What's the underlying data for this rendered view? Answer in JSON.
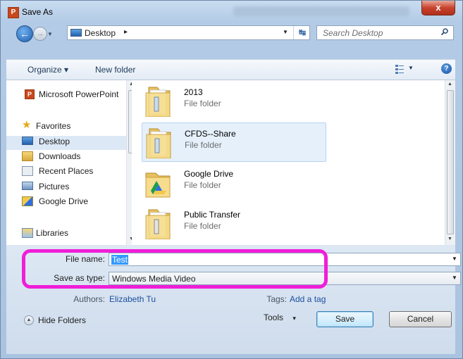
{
  "window": {
    "title": "Save As",
    "app_icon_letter": "P",
    "close_glyph": "x"
  },
  "address_bar": {
    "location": "Desktop",
    "chevron": "▸",
    "search_placeholder": "Search Desktop"
  },
  "toolbar": {
    "organize_label": "Organize ▾",
    "new_folder_label": "New folder",
    "help_glyph": "?"
  },
  "nav_pane": {
    "items": [
      {
        "label": "Microsoft PowerPoint",
        "icon": "powerpoint-icon"
      },
      {
        "label": "Favorites",
        "icon": "star-icon"
      },
      {
        "label": "Desktop",
        "icon": "desktop-icon",
        "selected": true
      },
      {
        "label": "Downloads",
        "icon": "downloads-icon"
      },
      {
        "label": "Recent Places",
        "icon": "recent-places-icon"
      },
      {
        "label": "Pictures",
        "icon": "pictures-icon"
      },
      {
        "label": "Google Drive",
        "icon": "google-drive-icon"
      },
      {
        "label": "Libraries",
        "icon": "libraries-icon"
      }
    ]
  },
  "files": [
    {
      "name": "2013",
      "type": "File folder",
      "icon": "folder-icon"
    },
    {
      "name": "CFDS--Share",
      "type": "File folder",
      "icon": "folder-icon",
      "selected": true
    },
    {
      "name": "Google Drive",
      "type": "File folder",
      "icon": "google-drive-folder-icon"
    },
    {
      "name": "Public Transfer",
      "type": "File folder",
      "icon": "folder-icon"
    }
  ],
  "form": {
    "file_name_label": "File name:",
    "file_name_value": "Test",
    "save_as_type_label": "Save as type:",
    "save_as_type_value": "Windows Media Video",
    "authors_label": "Authors:",
    "authors_value": "Elizabeth Tu",
    "tags_label": "Tags:",
    "tags_value": "Add a tag"
  },
  "footer": {
    "hide_folders_label": "Hide Folders",
    "tools_label": "Tools",
    "tools_arrow": "▾",
    "save_label": "Save",
    "cancel_label": "Cancel"
  },
  "colors": {
    "highlight_annotation": "#f01ed8",
    "selection": "#3399ff",
    "link": "#1c4e9e"
  }
}
